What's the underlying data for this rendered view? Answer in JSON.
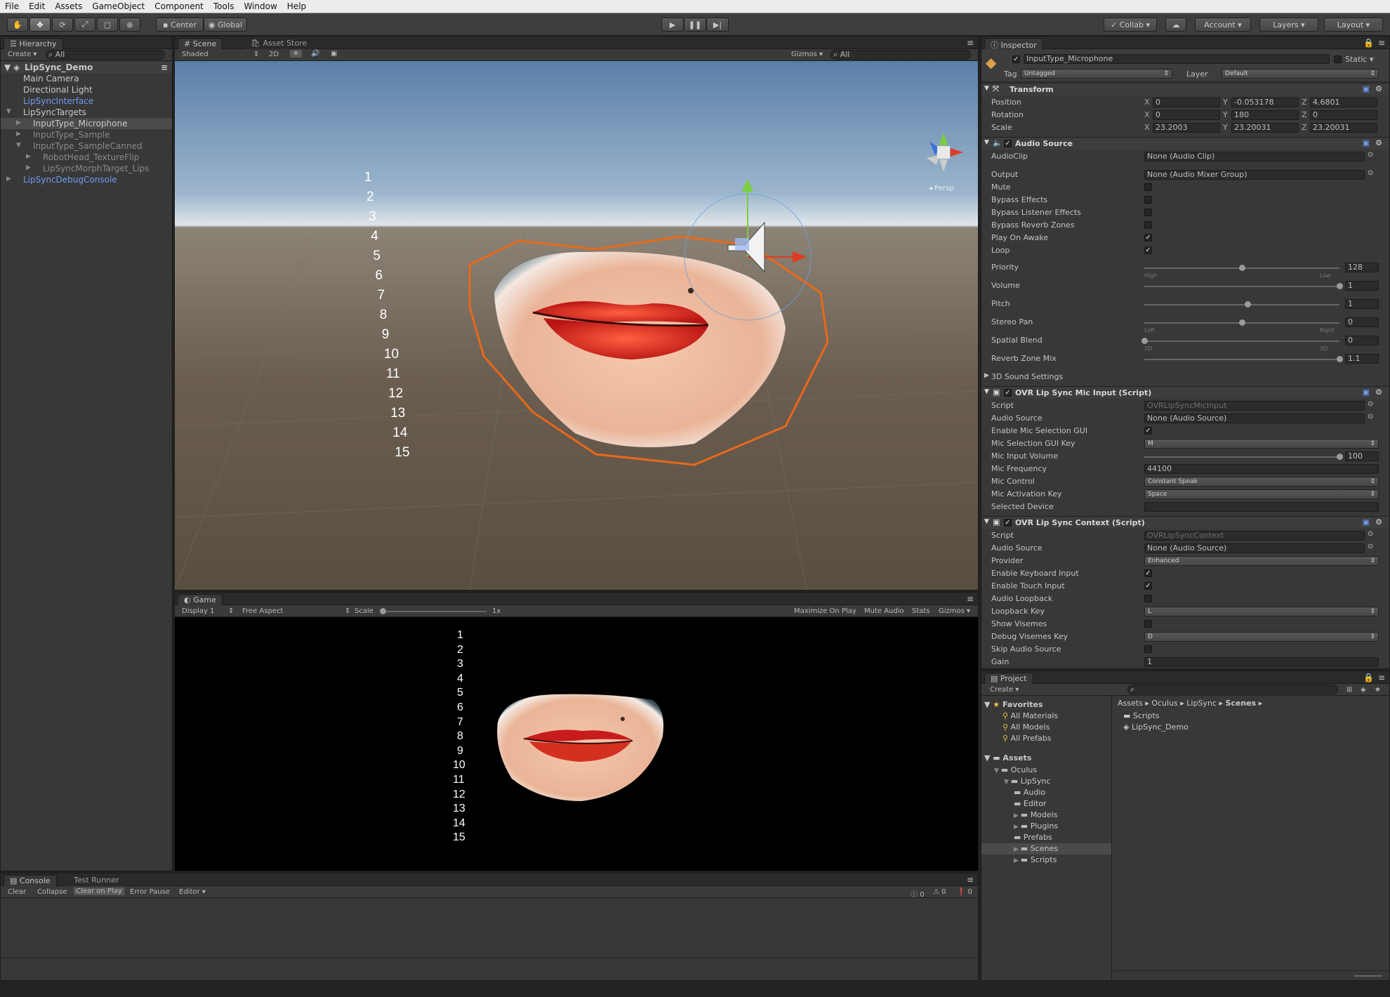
{
  "menu": [
    "File",
    "Edit",
    "Assets",
    "GameObject",
    "Component",
    "Tools",
    "Window",
    "Help"
  ],
  "toolbar": {
    "pivot": "Center",
    "space": "Global",
    "collab": "Collab ▾",
    "account": "Account",
    "layers": "Layers",
    "layout": "Layout"
  },
  "hierarchy": {
    "tab": "Hierarchy",
    "create": "Create ▾",
    "search_placeholder": "All",
    "scene": "LipSync_Demo",
    "items": [
      {
        "label": "Main Camera",
        "indent": 1,
        "style": "normal"
      },
      {
        "label": "Directional Light",
        "indent": 1,
        "style": "normal"
      },
      {
        "label": "LipSyncInterface",
        "indent": 1,
        "style": "blue"
      },
      {
        "label": "LipSyncTargets",
        "indent": 1,
        "style": "normal",
        "arrow": "▼"
      },
      {
        "label": "InputType_Microphone",
        "indent": 2,
        "style": "normal",
        "arrow": "▶",
        "selected": true
      },
      {
        "label": "InputType_Sample",
        "indent": 2,
        "style": "dim",
        "arrow": "▶"
      },
      {
        "label": "InputType_SampleCanned",
        "indent": 2,
        "style": "dim",
        "arrow": "▼"
      },
      {
        "label": "RobotHead_TextureFlip",
        "indent": 3,
        "style": "dim",
        "arrow": "▶"
      },
      {
        "label": "LipSyncMorphTarget_Lips",
        "indent": 3,
        "style": "dim",
        "arrow": "▶"
      },
      {
        "label": "LipSyncDebugConsole",
        "indent": 1,
        "style": "blue",
        "arrow": "▶"
      }
    ]
  },
  "scene": {
    "tab": "Scene",
    "asset_store_tab": "Asset Store",
    "shading": "Shaded",
    "mode2d": "2D",
    "gizmos": "Gizmos ▾",
    "search_placeholder": "All",
    "persp": "Persp",
    "numbers": [
      "1",
      "2",
      "3",
      "4",
      "5",
      "6",
      "7",
      "8",
      "9",
      "10",
      "11",
      "12",
      "13",
      "14",
      "15"
    ]
  },
  "game": {
    "tab": "Game",
    "display": "Display 1",
    "aspect": "Free Aspect",
    "scale_label": "Scale",
    "scale_value": "1x",
    "maximize": "Maximize On Play",
    "mute": "Mute Audio",
    "stats": "Stats",
    "gizmos": "Gizmos ▾",
    "numbers": [
      "1",
      "2",
      "3",
      "4",
      "5",
      "6",
      "7",
      "8",
      "9",
      "10",
      "11",
      "12",
      "13",
      "14",
      "15"
    ]
  },
  "console": {
    "tab": "Console",
    "test_tab": "Test Runner",
    "buttons": [
      "Clear",
      "Collapse",
      "Clear on Play",
      "Error Pause",
      "Editor ▾"
    ],
    "counts": [
      "0",
      "0",
      "0"
    ]
  },
  "inspector": {
    "tab": "Inspector",
    "object_name": "InputType_Microphone",
    "static_label": "Static ▾",
    "tag_label": "Tag",
    "tag_value": "Untagged",
    "layer_label": "Layer",
    "layer_value": "Default",
    "transform": {
      "title": "Transform",
      "rows": [
        {
          "label": "Position",
          "x": "0",
          "y": "-0.053178",
          "z": "4.6801"
        },
        {
          "label": "Rotation",
          "x": "0",
          "y": "180",
          "z": "0"
        },
        {
          "label": "Scale",
          "x": "23.2003",
          "y": "23.20031",
          "z": "23.20031"
        }
      ]
    },
    "audio_source": {
      "title": "Audio Source",
      "audioclip_label": "AudioClip",
      "audioclip_value": "None (Audio Clip)",
      "output_label": "Output",
      "output_value": "None (Audio Mixer Group)",
      "mute": "Mute",
      "bypass_effects": "Bypass Effects",
      "bypass_listener": "Bypass Listener Effects",
      "bypass_reverb": "Bypass Reverb Zones",
      "play_on_awake": "Play On Awake",
      "loop": "Loop",
      "priority_label": "Priority",
      "priority_value": "128",
      "priority_level": 0.5,
      "priority_high": "High",
      "priority_low": "Low",
      "volume_label": "Volume",
      "volume_value": "1",
      "pitch_label": "Pitch",
      "pitch_value": "1",
      "stereo_label": "Stereo Pan",
      "stereo_value": "0",
      "stereo_left": "Left",
      "stereo_right": "Right",
      "spatial_label": "Spatial Blend",
      "spatial_value": "0",
      "spatial_2d": "2D",
      "spatial_3d": "3D",
      "reverb_label": "Reverb Zone Mix",
      "reverb_value": "1.1",
      "sound3d": "3D Sound Settings"
    },
    "mic_input": {
      "title": "OVR Lip Sync Mic Input (Script)",
      "script_label": "Script",
      "script_value": "OVRLipSyncMicInput",
      "audio_source_label": "Audio Source",
      "audio_source_value": "None (Audio Source)",
      "enable_gui": "Enable Mic Selection GUI",
      "gui_key_label": "Mic Selection GUI Key",
      "gui_key_value": "M",
      "volume_label": "Mic Input Volume",
      "volume_value": "100",
      "freq_label": "Mic Frequency",
      "freq_value": "44100",
      "control_label": "Mic Control",
      "control_value": "Constant Speak",
      "activation_label": "Mic Activation Key",
      "activation_value": "Space",
      "device_label": "Selected Device",
      "device_value": ""
    },
    "context": {
      "title": "OVR Lip Sync Context (Script)",
      "script_label": "Script",
      "script_value": "OVRLipSyncContext",
      "audio_source_label": "Audio Source",
      "audio_source_value": "None (Audio Source)",
      "provider_label": "Provider",
      "provider_value": "Enhanced",
      "keyboard": "Enable Keyboard Input",
      "touch": "Enable Touch Input",
      "loopback": "Audio Loopback",
      "loopback_key_label": "Loopback Key",
      "loopback_key_value": "L",
      "show_visemes": "Show Visemes",
      "debug_key_label": "Debug Visemes Key",
      "debug_key_value": "D",
      "skip_audio": "Skip Audio Source",
      "gain_label": "Gain",
      "gain_value": "1"
    }
  },
  "project": {
    "tab": "Project",
    "create": "Create ▾",
    "favorites": "Favorites",
    "fav_items": [
      "All Materials",
      "All Models",
      "All Prefabs"
    ],
    "assets": "Assets",
    "tree": [
      {
        "label": "Oculus",
        "indent": 1
      },
      {
        "label": "LipSync",
        "indent": 2
      },
      {
        "label": "Audio",
        "indent": 3
      },
      {
        "label": "Editor",
        "indent": 3
      },
      {
        "label": "Models",
        "indent": 3
      },
      {
        "label": "Plugins",
        "indent": 3
      },
      {
        "label": "Prefabs",
        "indent": 3
      },
      {
        "label": "Scenes",
        "indent": 3,
        "selected": true
      },
      {
        "label": "Scripts",
        "indent": 3
      }
    ],
    "breadcrumb": [
      "Assets",
      "Oculus",
      "LipSync",
      "Scenes"
    ],
    "files": [
      "Scripts",
      "LipSync_Demo"
    ]
  },
  "colors": {
    "accent": "#3d6fd6",
    "orange": "#e8691a"
  }
}
